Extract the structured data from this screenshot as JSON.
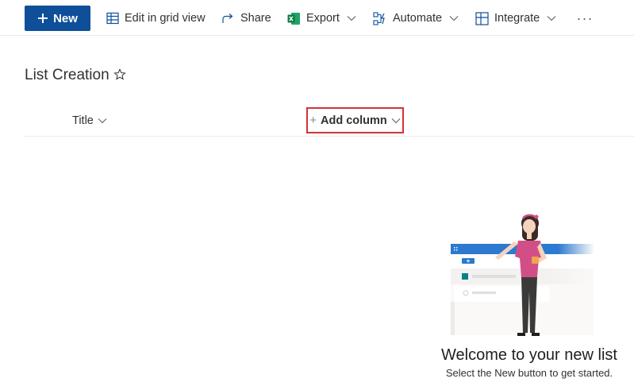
{
  "toolbar": {
    "new_label": "New",
    "edit_grid_label": "Edit in grid view",
    "share_label": "Share",
    "export_label": "Export",
    "automate_label": "Automate",
    "integrate_label": "Integrate",
    "more_label": "···"
  },
  "list": {
    "title": "List Creation",
    "columns": {
      "title_label": "Title",
      "add_column_label": "Add column"
    }
  },
  "empty_state": {
    "heading": "Welcome to your new list",
    "subtext": "Select the New button to get started."
  },
  "colors": {
    "accent": "#0f4f9a",
    "highlight_border": "#d13438",
    "excel_green": "#107c41",
    "illustration_bar": "#2b79d0",
    "figure_top": "#d14f86"
  },
  "icons": [
    "plus-icon",
    "grid-icon",
    "share-icon",
    "excel-icon",
    "automate-icon",
    "integrate-icon",
    "more-icon",
    "star-icon",
    "chevron-down-icon"
  ]
}
